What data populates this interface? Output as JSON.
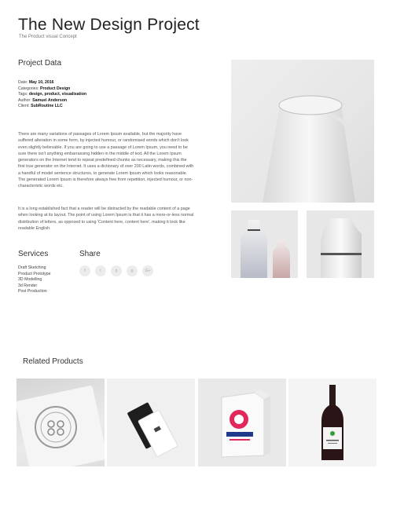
{
  "header": {
    "title": "The New Design Project",
    "subtitle": "The Product visual Concept"
  },
  "project_data": {
    "heading": "Project Data",
    "fields": [
      {
        "label": "Date: ",
        "value": "May 10, 2016"
      },
      {
        "label": "Categories: ",
        "value": "Product Design"
      },
      {
        "label": "Tags: ",
        "value": "design, product, visualisation"
      },
      {
        "label": "Author: ",
        "value": "Samuel Anderson"
      },
      {
        "label": "Client: ",
        "value": "SubRoutine LLC"
      }
    ]
  },
  "description": {
    "paragraph1": "There are many variations of passages of Lorem Ipsum available, but the majority have suffered alteration in some form, by injected humour, or randomised words which don't look even slightly believable. If you are going to use a passage of Lorem Ipsum, you need to be sure there isn't anything embarrassing hidden in the middle of text. All the Lorem Ipsum generators on the Internet tend to repeat predefined chunks as necessary, making this the first true generator on the Internet. It uses a dictionary of over 200 Latin words, combined with a handful of model sentence structures, to generate Lorem Ipsum which looks reasonable. The generated Lorem Ipsum is therefore always free from repetition, injected humour, or non-characteristic words etc.",
    "paragraph2": "It is a long established fact that a reader will be distracted by the readable content of a page when looking at its layout. The point of using Lorem Ipsum is that it has a more-or-less normal distribution of letters, as opposed to using 'Content here, content here', making it look like readable English."
  },
  "services": {
    "heading": "Services",
    "items": [
      "Draft Sketching",
      "Product Prototype",
      "3D Modelling",
      "3d Render",
      "Post Production"
    ]
  },
  "share": {
    "heading": "Share",
    "buttons": [
      {
        "icon": "facebook-icon",
        "glyph": "f"
      },
      {
        "icon": "twitter-icon",
        "glyph": "t"
      },
      {
        "icon": "pinterest-icon",
        "glyph": "p"
      },
      {
        "icon": "instagram-icon",
        "glyph": "◎"
      },
      {
        "icon": "google-plus-icon",
        "glyph": "G+"
      }
    ]
  },
  "related": {
    "heading": "Related Products"
  }
}
